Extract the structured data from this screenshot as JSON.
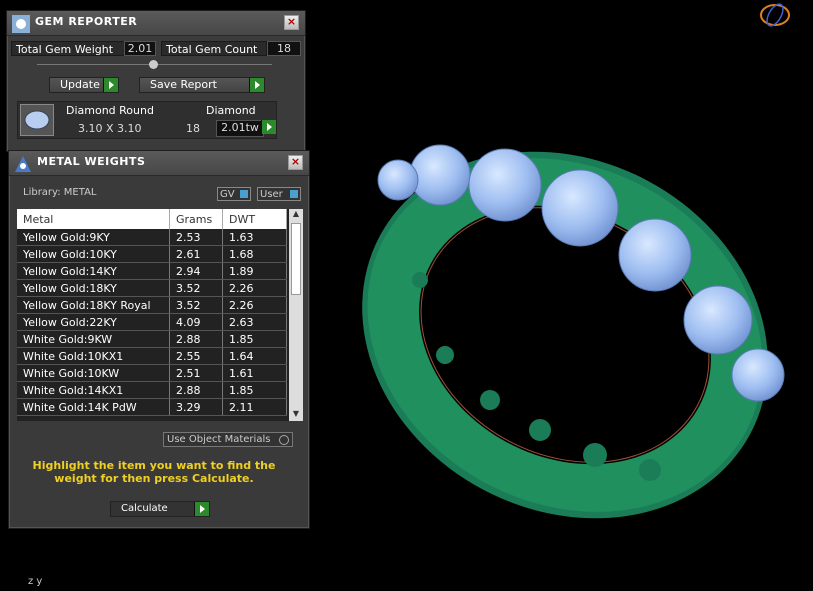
{
  "gem_reporter": {
    "title": "GEM REPORTER",
    "total_weight_label": "Total Gem Weight",
    "total_weight_value": "2.01",
    "total_count_label": "Total Gem Count",
    "total_count_value": "18",
    "update_label": "Update",
    "save_report_label": "Save Report",
    "gem_row": {
      "name": "Diamond Round",
      "size": "3.10 X 3.10",
      "type": "Diamond",
      "count": "18",
      "weight": "2.01tw"
    }
  },
  "metal_weights": {
    "title": "METAL WEIGHTS",
    "library_label": "Library: METAL",
    "gv_label": "GV",
    "user_label": "User",
    "columns": [
      "Metal",
      "Grams",
      "DWT"
    ],
    "rows": [
      {
        "metal": "Yellow Gold:9KY",
        "grams": "2.53",
        "dwt": "1.63"
      },
      {
        "metal": "Yellow Gold:10KY",
        "grams": "2.61",
        "dwt": "1.68"
      },
      {
        "metal": "Yellow Gold:14KY",
        "grams": "2.94",
        "dwt": "1.89"
      },
      {
        "metal": "Yellow Gold:18KY",
        "grams": "3.52",
        "dwt": "2.26"
      },
      {
        "metal": "Yellow Gold:18KY Royal",
        "grams": "3.52",
        "dwt": "2.26"
      },
      {
        "metal": "Yellow Gold:22KY",
        "grams": "4.09",
        "dwt": "2.63"
      },
      {
        "metal": "White Gold:9KW",
        "grams": "2.88",
        "dwt": "1.85"
      },
      {
        "metal": "White Gold:10KX1",
        "grams": "2.55",
        "dwt": "1.64"
      },
      {
        "metal": "White Gold:10KW",
        "grams": "2.51",
        "dwt": "1.61"
      },
      {
        "metal": "White Gold:14KX1",
        "grams": "2.88",
        "dwt": "1.85"
      },
      {
        "metal": "White Gold:14K PdW",
        "grams": "3.29",
        "dwt": "2.11"
      }
    ],
    "use_object_materials_label": "Use Object Materials",
    "hint": "Highlight the item you want to find the weight for then press Calculate.",
    "calculate_label": "Calculate"
  },
  "viewport": {
    "axis_label": "Z Y",
    "ring_color": "#1f8a63",
    "gem_color": "#a8c8f0"
  }
}
